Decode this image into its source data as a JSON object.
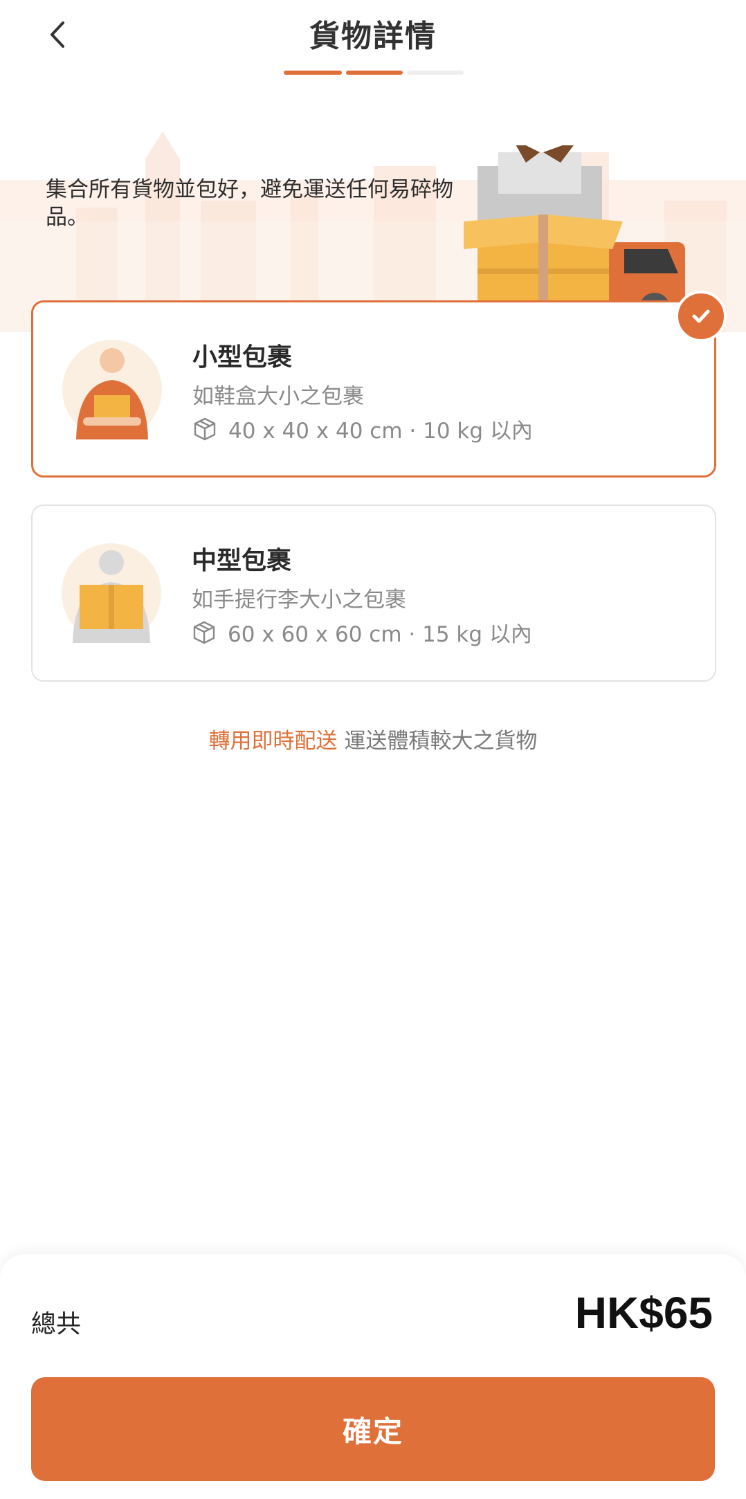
{
  "header": {
    "title": "貨物詳情",
    "progress_steps": 3,
    "progress_completed": 2
  },
  "hero": {
    "text": "集合所有貨物並包好，避免運送任何易碎物品。"
  },
  "options": [
    {
      "title": "小型包裹",
      "description": "如鞋盒大小之包裹",
      "spec": "40 x 40  x 40 cm · 10 kg 以內",
      "selected": true
    },
    {
      "title": "中型包裹",
      "description": "如手提行李大小之包裹",
      "spec": "60 x 60  x 60 cm · 15 kg 以內",
      "selected": false
    }
  ],
  "alternative": {
    "link_text": "轉用即時配送",
    "text": " 運送體積較大之貨物"
  },
  "footer": {
    "total_label": "總共",
    "total_value": "HK$65",
    "confirm_label": "確定"
  },
  "colors": {
    "accent": "#e0703a",
    "progress_inactive": "#eeeeee",
    "hero_bg": "#fdf1ea",
    "box_yellow": "#f4b443",
    "box_gray": "#c9c9c9"
  },
  "icons": [
    "chevron-left-icon",
    "check-icon",
    "box-icon",
    "delivery-truck-illustration"
  ]
}
